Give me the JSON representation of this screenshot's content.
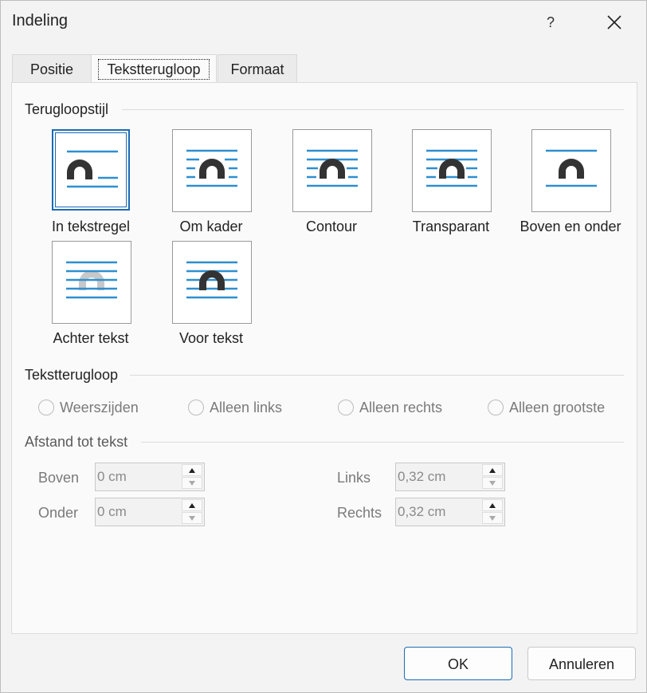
{
  "dialog": {
    "title": "Indeling",
    "help": "?",
    "close": "×"
  },
  "tabs": [
    {
      "label": "Positie"
    },
    {
      "label": "Tekstterugloop"
    },
    {
      "label": "Formaat"
    }
  ],
  "wrap_style": {
    "heading": "Terugloopstijl",
    "options": [
      {
        "label": "In tekstregel",
        "icon": "in-line-wrap-icon",
        "selected": true
      },
      {
        "label": "Om kader",
        "icon": "square-wrap-icon",
        "selected": false
      },
      {
        "label": "Contour",
        "icon": "tight-wrap-icon",
        "selected": false
      },
      {
        "label": "Transparant",
        "icon": "through-wrap-icon",
        "selected": false
      },
      {
        "label": "Boven en onder",
        "icon": "top-bottom-wrap-icon",
        "selected": false
      },
      {
        "label": "Achter tekst",
        "icon": "behind-text-icon",
        "selected": false
      },
      {
        "label": "Voor tekst",
        "icon": "in-front-text-icon",
        "selected": false
      }
    ]
  },
  "wrap_text": {
    "heading": "Tekstterugloop",
    "options": [
      {
        "label": "Weerszijden"
      },
      {
        "label": "Alleen links"
      },
      {
        "label": "Alleen rechts"
      },
      {
        "label": "Alleen grootste"
      }
    ]
  },
  "distance": {
    "heading": "Afstand tot tekst",
    "top": {
      "label": "Boven",
      "value": "0 cm"
    },
    "bottom": {
      "label": "Onder",
      "value": "0 cm"
    },
    "left": {
      "label": "Links",
      "value": "0,32 cm"
    },
    "right": {
      "label": "Rechts",
      "value": "0,32 cm"
    }
  },
  "buttons": {
    "ok": "OK",
    "cancel": "Annuleren"
  },
  "colors": {
    "accent": "#1a6bb5",
    "line": "#2e8fd0",
    "shape": "#333333",
    "shape_behind": "#c8c8c8"
  }
}
